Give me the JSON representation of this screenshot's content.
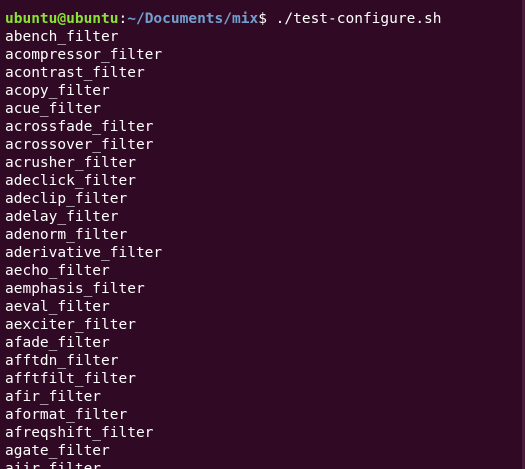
{
  "terminal": {
    "prompt": {
      "user_host": "ubuntu@ubuntu",
      "separator": ":",
      "path": "~/Documents/mix",
      "symbol": "$ ",
      "command": "./test-configure.sh"
    },
    "output": [
      "abench_filter",
      "acompressor_filter",
      "acontrast_filter",
      "acopy_filter",
      "acue_filter",
      "acrossfade_filter",
      "acrossover_filter",
      "acrusher_filter",
      "adeclick_filter",
      "adeclip_filter",
      "adelay_filter",
      "adenorm_filter",
      "aderivative_filter",
      "aecho_filter",
      "aemphasis_filter",
      "aeval_filter",
      "aexciter_filter",
      "afade_filter",
      "afftdn_filter",
      "afftfilt_filter",
      "afir_filter",
      "aformat_filter",
      "afreqshift_filter",
      "agate_filter",
      "aiir_filter"
    ],
    "colors": {
      "background": "#300a24",
      "user_host": "#8ae234",
      "path": "#729fcf",
      "text": "#ffffff"
    }
  }
}
